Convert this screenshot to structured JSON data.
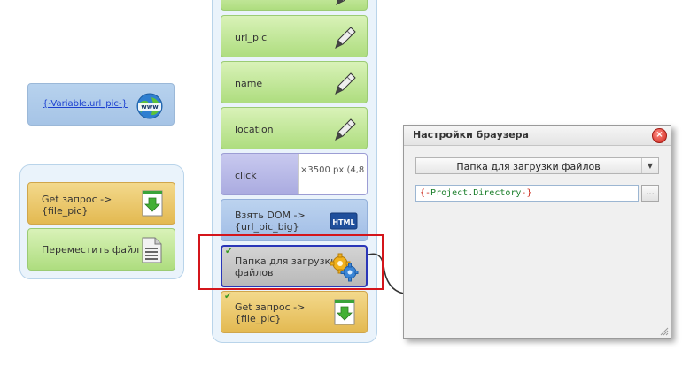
{
  "variable_block": {
    "label": "{-Variable.url_pic-}",
    "icon": "www-globe-icon"
  },
  "left_group": {
    "items": [
      {
        "label": "Get запрос ->\n{file_pic}",
        "icon": "download-icon"
      },
      {
        "label": "Переместить файл",
        "icon": "document-icon"
      }
    ]
  },
  "column": {
    "items": [
      {
        "label": "",
        "icon": "pen-icon"
      },
      {
        "label": "url_pic",
        "icon": "pen-icon"
      },
      {
        "label": "name",
        "icon": "pen-icon"
      },
      {
        "label": "location",
        "icon": "pen-icon"
      },
      {
        "label": "click",
        "preview": "×3500 px (4,8"
      },
      {
        "label": "Взять DOM ->\n{url_pic_big}",
        "icon": "html-icon"
      },
      {
        "label": "Папка для загрузки\nфайлов",
        "icon": "gears-icon"
      },
      {
        "label": "Get запрос ->\n{file_pic}",
        "icon": "download-icon"
      }
    ]
  },
  "dialog": {
    "title": "Настройки браузера",
    "dropdown_value": "Папка для загрузки файлов",
    "field": {
      "open": "{-",
      "word1": "Project",
      "dot": ".",
      "word2": "Directory",
      "close": "-}"
    },
    "browse_label": "..."
  },
  "colors": {
    "highlight": "#d4151b",
    "selected_border": "#2a36b8",
    "variable_red": "#cc2a1c",
    "variable_green": "#1b7f2b"
  }
}
